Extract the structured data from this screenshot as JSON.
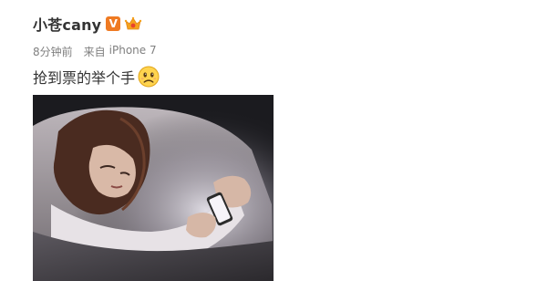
{
  "post": {
    "author": {
      "name": "小苍cany",
      "verified_badge": "V",
      "badge_color": "#ef7a22",
      "level_badge_icon": "vip-crown-icon"
    },
    "meta": {
      "time": "8分钟前",
      "source_prefix": "来自",
      "device": "iPhone 7"
    },
    "text": "抢到票的举个手",
    "emoji_icon": "sad-face-emoji-icon",
    "image": {
      "description_icon": "woman-in-bed-with-phone-illustration"
    }
  }
}
